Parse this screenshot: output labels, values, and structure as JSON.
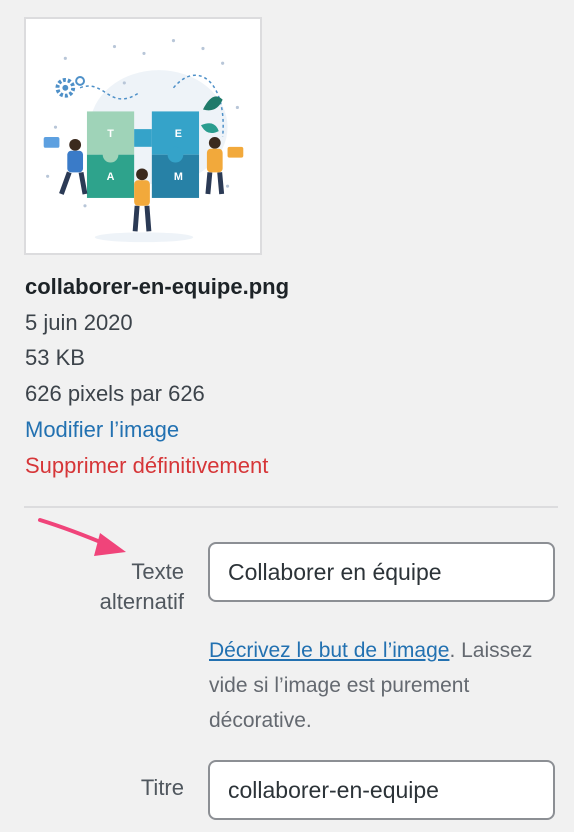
{
  "attachment": {
    "thumbnail_icon": "team-puzzle-illustration",
    "thumbnail_letters": [
      "T",
      "E",
      "A",
      "M"
    ],
    "filename": "collaborer-en-equipe.png",
    "upload_date": "5 juin 2020",
    "file_size": "53 KB",
    "dimensions": "626 pixels par 626",
    "edit_link": "Modifier l’image",
    "delete_link": "Supprimer définitivement"
  },
  "fields": {
    "alt_text": {
      "label": "Texte alternatif",
      "value": "Collaborer en équipe",
      "help_link": "Décrivez le but de l’image",
      "help_period": ".",
      "help_text": " Laissez vide si l’image est purement décorative."
    },
    "title": {
      "label": "Titre",
      "value": "collaborer-en-equipe"
    }
  },
  "annotation": {
    "icon": "arrow-icon",
    "color": "#f0447a"
  },
  "colors": {
    "link": "#2271b1",
    "delete": "#d63638",
    "background": "#f1f1f1"
  }
}
